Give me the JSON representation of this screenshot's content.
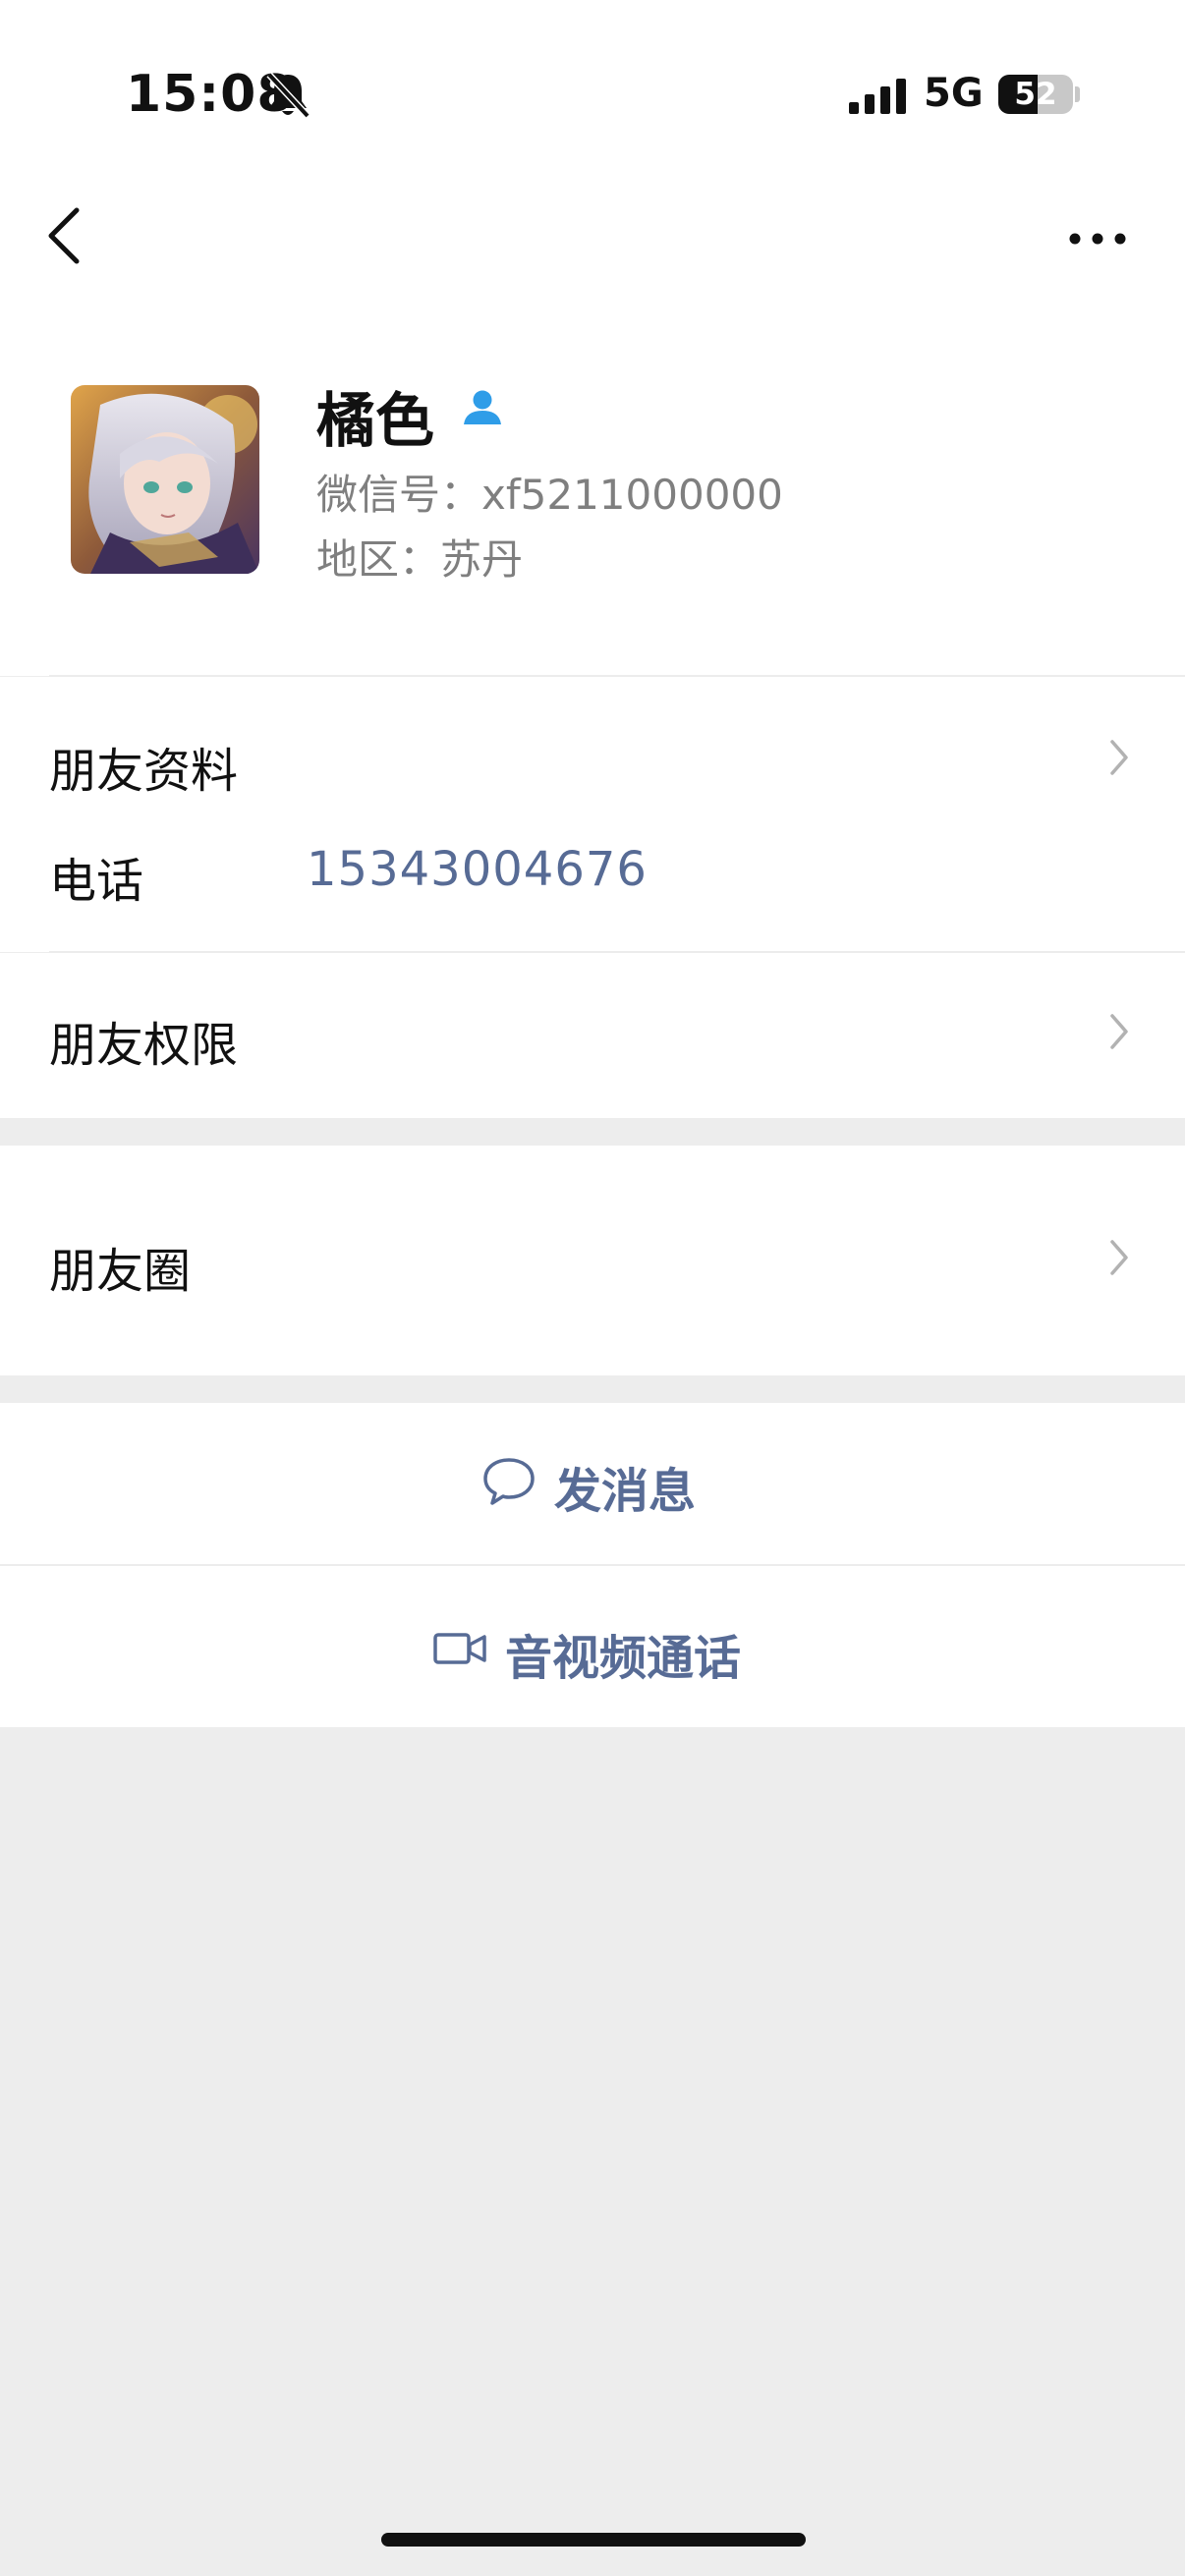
{
  "status_bar": {
    "time": "15:08",
    "network": "5G",
    "battery": 52,
    "battery_label": "52",
    "icons": [
      "bell-off-icon",
      "signal-bars-icon",
      "battery-icon"
    ]
  },
  "nav": {
    "back_icon": "chevron-left-icon",
    "more_icon": "ellipsis-icon"
  },
  "profile": {
    "name": "橘色",
    "badge_icon": "person-icon",
    "badge_color": "#2f9de8",
    "wechat_id": "微信号：xf5211000000",
    "region": "地区：苏丹"
  },
  "rows": {
    "friend_info": "朋友资料",
    "phone_label": "电话",
    "phone_value": "15343004676",
    "friend_permissions": "朋友权限",
    "moments": "朋友圈"
  },
  "actions": {
    "send_message": "发消息",
    "send_message_icon": "chat-bubble-icon",
    "av_call": "音视频通话",
    "av_call_icon": "video-camera-icon",
    "accent_color": "#576b95"
  }
}
